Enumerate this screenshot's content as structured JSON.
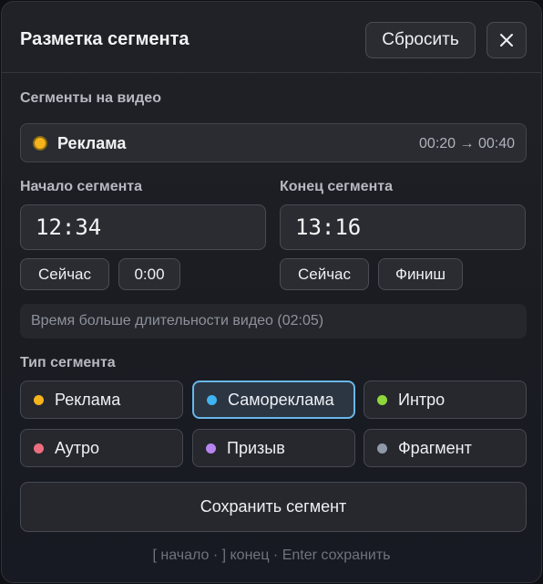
{
  "header": {
    "title": "Разметка сегмента",
    "reset_label": "Сбросить",
    "close_icon": "close-icon"
  },
  "segments_section": {
    "label": "Сегменты на видео",
    "items": [
      {
        "name": "Реклама",
        "range": "00:20 → 00:40",
        "color": "#f5b41c"
      }
    ]
  },
  "start": {
    "label": "Начало сегмента",
    "value": "12:34",
    "buttons": [
      "Сейчас",
      "0:00"
    ]
  },
  "end": {
    "label": "Конец сегмента",
    "value": "13:16",
    "buttons": [
      "Сейчас",
      "Финиш"
    ]
  },
  "warning": "Время больше длительности видео (02:05)",
  "types": {
    "label": "Тип сегмента",
    "selected": "Самореклама",
    "items": [
      {
        "label": "Реклама",
        "color": "#f5b41c"
      },
      {
        "label": "Самореклама",
        "color": "#3fb4ef"
      },
      {
        "label": "Интро",
        "color": "#8fd63a"
      },
      {
        "label": "Аутро",
        "color": "#ee6d7f"
      },
      {
        "label": "Призыв",
        "color": "#b784f0"
      },
      {
        "label": "Фрагмент",
        "color": "#8f98a8"
      }
    ]
  },
  "save_label": "Сохранить сегмент",
  "hint": "[ начало · ] конец · Enter сохранить"
}
